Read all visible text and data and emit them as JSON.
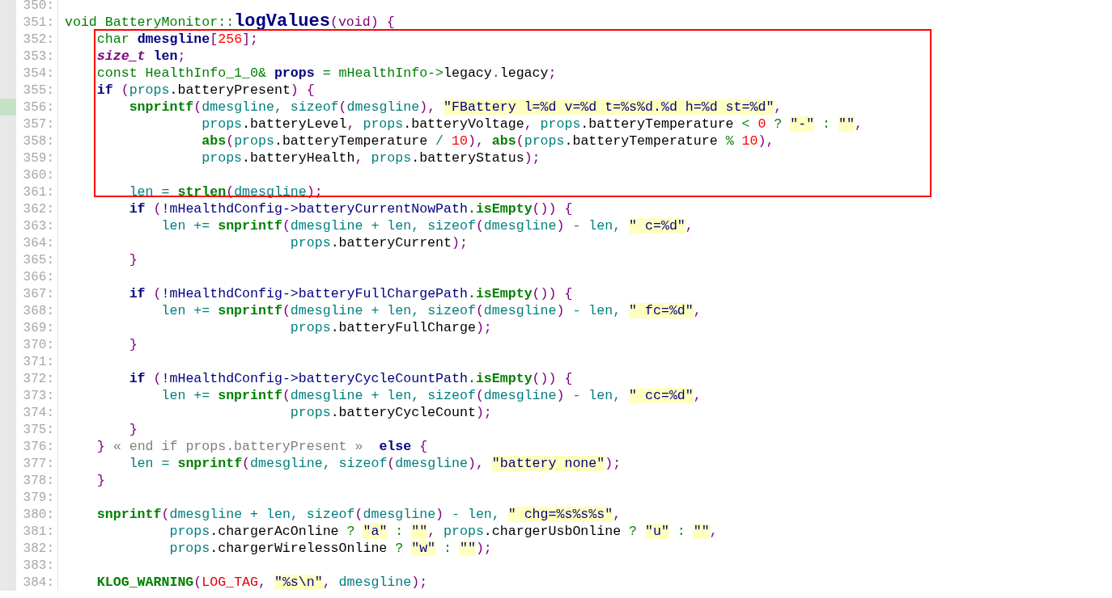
{
  "lines": [
    {
      "number": "350:",
      "changed": false
    },
    {
      "number": "351:",
      "changed": false,
      "tokens": [
        {
          "kind": "type",
          "text": "void BatteryMonitor::"
        },
        {
          "kind": "title",
          "text": "logValues"
        },
        {
          "kind": "punct",
          "text": "(void) {"
        }
      ]
    },
    {
      "number": "352:",
      "changed": false,
      "tokens": [
        {
          "kind": "type",
          "text": "    char "
        },
        {
          "kind": "decl",
          "text": "dmesgline"
        },
        {
          "kind": "punct",
          "text": "["
        },
        {
          "kind": "number",
          "text": "256"
        },
        {
          "kind": "punct",
          "text": "];"
        }
      ]
    },
    {
      "number": "353:",
      "changed": false,
      "tokens": [
        {
          "kind": "italic",
          "text": "    size_t"
        },
        {
          "kind": "decl",
          "text": " len"
        },
        {
          "kind": "punct",
          "text": ";"
        }
      ]
    },
    {
      "number": "354:",
      "changed": false,
      "tokens": [
        {
          "kind": "type",
          "text": "    const HealthInfo_1_0& "
        },
        {
          "kind": "decl",
          "text": "props"
        },
        {
          "kind": "type",
          "text": " = mHealthInfo->"
        },
        {
          "kind": "plain",
          "text": "legacy"
        },
        {
          "kind": "type",
          "text": "."
        },
        {
          "kind": "plain",
          "text": "legacy"
        },
        {
          "kind": "punct",
          "text": ";"
        }
      ]
    },
    {
      "number": "355:",
      "changed": false,
      "tokens": [
        {
          "kind": "decl",
          "text": "    if "
        },
        {
          "kind": "punct",
          "text": "("
        },
        {
          "kind": "var",
          "text": "props"
        },
        {
          "kind": "plain",
          "text": ".batteryPresent"
        },
        {
          "kind": "punct",
          "text": ") {"
        }
      ]
    },
    {
      "number": "356:",
      "changed": true,
      "tokens": [
        {
          "kind": "func",
          "text": "        snprintf"
        },
        {
          "kind": "punct",
          "text": "("
        },
        {
          "kind": "var",
          "text": "dmesgline, sizeof"
        },
        {
          "kind": "punct",
          "text": "("
        },
        {
          "kind": "var",
          "text": "dmesgline"
        },
        {
          "kind": "punct",
          "text": "), "
        },
        {
          "kind": "string",
          "text": "\"FBattery l=%d v=%d t=%s%d.%d h=%d st=%d\""
        },
        {
          "kind": "punct",
          "text": ","
        }
      ]
    },
    {
      "number": "357:",
      "changed": false,
      "tokens": [
        {
          "kind": "var",
          "text": "                 props"
        },
        {
          "kind": "plain",
          "text": ".batteryLevel"
        },
        {
          "kind": "punct",
          "text": ", "
        },
        {
          "kind": "var",
          "text": "props"
        },
        {
          "kind": "plain",
          "text": ".batteryVoltage"
        },
        {
          "kind": "punct",
          "text": ", "
        },
        {
          "kind": "var",
          "text": "props"
        },
        {
          "kind": "plain",
          "text": ".batteryTemperature "
        },
        {
          "kind": "op",
          "text": "< "
        },
        {
          "kind": "number",
          "text": "0"
        },
        {
          "kind": "op",
          "text": " ? "
        },
        {
          "kind": "string",
          "text": "\"-\""
        },
        {
          "kind": "op",
          "text": " : "
        },
        {
          "kind": "string",
          "text": "\"\""
        },
        {
          "kind": "punct",
          "text": ","
        }
      ]
    },
    {
      "number": "358:",
      "changed": false,
      "tokens": [
        {
          "kind": "func",
          "text": "                 abs"
        },
        {
          "kind": "punct",
          "text": "("
        },
        {
          "kind": "var",
          "text": "props"
        },
        {
          "kind": "plain",
          "text": ".batteryTemperature "
        },
        {
          "kind": "var",
          "text": "/ "
        },
        {
          "kind": "number",
          "text": "10"
        },
        {
          "kind": "punct",
          "text": "), "
        },
        {
          "kind": "func",
          "text": "abs"
        },
        {
          "kind": "punct",
          "text": "("
        },
        {
          "kind": "var",
          "text": "props"
        },
        {
          "kind": "plain",
          "text": ".batteryTemperature "
        },
        {
          "kind": "op",
          "text": "% "
        },
        {
          "kind": "number",
          "text": "10"
        },
        {
          "kind": "punct",
          "text": "),"
        }
      ]
    },
    {
      "number": "359:",
      "changed": false,
      "tokens": [
        {
          "kind": "var",
          "text": "                 props"
        },
        {
          "kind": "plain",
          "text": ".batteryHealth"
        },
        {
          "kind": "punct",
          "text": ", "
        },
        {
          "kind": "var",
          "text": "props"
        },
        {
          "kind": "plain",
          "text": ".batteryStatus"
        },
        {
          "kind": "punct",
          "text": ");"
        }
      ]
    },
    {
      "number": "360:",
      "changed": false
    },
    {
      "number": "361:",
      "changed": false,
      "tokens": [
        {
          "kind": "var",
          "text": "        len = "
        },
        {
          "kind": "func",
          "text": "strlen"
        },
        {
          "kind": "punct",
          "text": "("
        },
        {
          "kind": "var",
          "text": "dmesgline"
        },
        {
          "kind": "punct",
          "text": ");"
        }
      ]
    },
    {
      "number": "362:",
      "changed": false,
      "tokens": [
        {
          "kind": "decl",
          "text": "        if "
        },
        {
          "kind": "punct",
          "text": "("
        },
        {
          "kind": "member",
          "text": "!mHealthdConfig->batteryCurrentNowPath"
        },
        {
          "kind": "func",
          "text": ".isEmpty"
        },
        {
          "kind": "punct",
          "text": "()) {"
        }
      ]
    },
    {
      "number": "363:",
      "changed": false,
      "tokens": [
        {
          "kind": "var",
          "text": "            len += "
        },
        {
          "kind": "func",
          "text": "snprintf"
        },
        {
          "kind": "punct",
          "text": "("
        },
        {
          "kind": "var",
          "text": "dmesgline + len, sizeof"
        },
        {
          "kind": "punct",
          "text": "("
        },
        {
          "kind": "var",
          "text": "dmesgline"
        },
        {
          "kind": "punct",
          "text": ") "
        },
        {
          "kind": "var",
          "text": "- len, "
        },
        {
          "kind": "string",
          "text": "\" c=%d\""
        },
        {
          "kind": "punct",
          "text": ","
        }
      ]
    },
    {
      "number": "364:",
      "changed": false,
      "tokens": [
        {
          "kind": "var",
          "text": "                            props"
        },
        {
          "kind": "plain",
          "text": ".batteryCurrent"
        },
        {
          "kind": "punct",
          "text": ");"
        }
      ]
    },
    {
      "number": "365:",
      "changed": false,
      "tokens": [
        {
          "kind": "punct",
          "text": "        }"
        }
      ]
    },
    {
      "number": "366:",
      "changed": false
    },
    {
      "number": "367:",
      "changed": false,
      "tokens": [
        {
          "kind": "decl",
          "text": "        if "
        },
        {
          "kind": "punct",
          "text": "("
        },
        {
          "kind": "member",
          "text": "!mHealthdConfig->batteryFullChargePath"
        },
        {
          "kind": "func",
          "text": ".isEmpty"
        },
        {
          "kind": "punct",
          "text": "()) {"
        }
      ]
    },
    {
      "number": "368:",
      "changed": false,
      "tokens": [
        {
          "kind": "var",
          "text": "            len += "
        },
        {
          "kind": "func",
          "text": "snprintf"
        },
        {
          "kind": "punct",
          "text": "("
        },
        {
          "kind": "var",
          "text": "dmesgline + len, sizeof"
        },
        {
          "kind": "punct",
          "text": "("
        },
        {
          "kind": "var",
          "text": "dmesgline"
        },
        {
          "kind": "punct",
          "text": ") "
        },
        {
          "kind": "var",
          "text": "- len, "
        },
        {
          "kind": "string",
          "text": "\" fc=%d\""
        },
        {
          "kind": "punct",
          "text": ","
        }
      ]
    },
    {
      "number": "369:",
      "changed": false,
      "tokens": [
        {
          "kind": "var",
          "text": "                            props"
        },
        {
          "kind": "plain",
          "text": ".batteryFullCharge"
        },
        {
          "kind": "punct",
          "text": ");"
        }
      ]
    },
    {
      "number": "370:",
      "changed": false,
      "tokens": [
        {
          "kind": "punct",
          "text": "        }"
        }
      ]
    },
    {
      "number": "371:",
      "changed": false
    },
    {
      "number": "372:",
      "changed": false,
      "tokens": [
        {
          "kind": "decl",
          "text": "        if "
        },
        {
          "kind": "punct",
          "text": "("
        },
        {
          "kind": "member",
          "text": "!mHealthdConfig->batteryCycleCountPath"
        },
        {
          "kind": "func",
          "text": ".isEmpty"
        },
        {
          "kind": "punct",
          "text": "()) {"
        }
      ]
    },
    {
      "number": "373:",
      "changed": false,
      "tokens": [
        {
          "kind": "var",
          "text": "            len += "
        },
        {
          "kind": "func",
          "text": "snprintf"
        },
        {
          "kind": "punct",
          "text": "("
        },
        {
          "kind": "var",
          "text": "dmesgline + len, sizeof"
        },
        {
          "kind": "punct",
          "text": "("
        },
        {
          "kind": "var",
          "text": "dmesgline"
        },
        {
          "kind": "punct",
          "text": ") "
        },
        {
          "kind": "var",
          "text": "- len, "
        },
        {
          "kind": "string",
          "text": "\" cc=%d\""
        },
        {
          "kind": "punct",
          "text": ","
        }
      ]
    },
    {
      "number": "374:",
      "changed": false,
      "tokens": [
        {
          "kind": "var",
          "text": "                            props"
        },
        {
          "kind": "plain",
          "text": ".batteryCycleCount"
        },
        {
          "kind": "punct",
          "text": ");"
        }
      ]
    },
    {
      "number": "375:",
      "changed": false,
      "tokens": [
        {
          "kind": "punct",
          "text": "        }"
        }
      ]
    },
    {
      "number": "376:",
      "changed": false,
      "tokens": [
        {
          "kind": "punct",
          "text": "    }"
        },
        {
          "kind": "comment",
          "text": " « end if props.batteryPresent »  "
        },
        {
          "kind": "decl",
          "text": "else "
        },
        {
          "kind": "punct",
          "text": "{"
        }
      ]
    },
    {
      "number": "377:",
      "changed": false,
      "tokens": [
        {
          "kind": "var",
          "text": "        len = "
        },
        {
          "kind": "func",
          "text": "snprintf"
        },
        {
          "kind": "punct",
          "text": "("
        },
        {
          "kind": "var",
          "text": "dmesgline, sizeof"
        },
        {
          "kind": "punct",
          "text": "("
        },
        {
          "kind": "var",
          "text": "dmesgline"
        },
        {
          "kind": "punct",
          "text": "), "
        },
        {
          "kind": "string",
          "text": "\"battery none\""
        },
        {
          "kind": "punct",
          "text": ");"
        }
      ]
    },
    {
      "number": "378:",
      "changed": false,
      "tokens": [
        {
          "kind": "punct",
          "text": "    }"
        }
      ]
    },
    {
      "number": "379:",
      "changed": false
    },
    {
      "number": "380:",
      "changed": false,
      "tokens": [
        {
          "kind": "func",
          "text": "    snprintf"
        },
        {
          "kind": "punct",
          "text": "("
        },
        {
          "kind": "var",
          "text": "dmesgline + len, sizeof"
        },
        {
          "kind": "punct",
          "text": "("
        },
        {
          "kind": "var",
          "text": "dmesgline"
        },
        {
          "kind": "punct",
          "text": ") "
        },
        {
          "kind": "var",
          "text": "- len, "
        },
        {
          "kind": "string",
          "text": "\" chg=%s%s%s\""
        },
        {
          "kind": "punct",
          "text": ","
        }
      ]
    },
    {
      "number": "381:",
      "changed": false,
      "tokens": [
        {
          "kind": "var",
          "text": "             props"
        },
        {
          "kind": "plain",
          "text": ".chargerAcOnline "
        },
        {
          "kind": "op",
          "text": "? "
        },
        {
          "kind": "string",
          "text": "\"a\""
        },
        {
          "kind": "op",
          "text": " : "
        },
        {
          "kind": "string",
          "text": "\"\""
        },
        {
          "kind": "punct",
          "text": ", "
        },
        {
          "kind": "var",
          "text": "props"
        },
        {
          "kind": "plain",
          "text": ".chargerUsbOnline "
        },
        {
          "kind": "op",
          "text": "? "
        },
        {
          "kind": "string",
          "text": "\"u\""
        },
        {
          "kind": "op",
          "text": " : "
        },
        {
          "kind": "string",
          "text": "\"\""
        },
        {
          "kind": "punct",
          "text": ","
        }
      ]
    },
    {
      "number": "382:",
      "changed": false,
      "tokens": [
        {
          "kind": "var",
          "text": "             props"
        },
        {
          "kind": "plain",
          "text": ".chargerWirelessOnline "
        },
        {
          "kind": "op",
          "text": "? "
        },
        {
          "kind": "string",
          "text": "\"w\""
        },
        {
          "kind": "op",
          "text": " : "
        },
        {
          "kind": "string",
          "text": "\"\""
        },
        {
          "kind": "punct",
          "text": ");"
        }
      ]
    },
    {
      "number": "383:",
      "changed": false
    },
    {
      "number": "384:",
      "changed": false,
      "tokens": [
        {
          "kind": "func",
          "text": "    KLOG_WARNING"
        },
        {
          "kind": "punct",
          "text": "("
        },
        {
          "kind": "macro",
          "text": "LOG_TAG"
        },
        {
          "kind": "punct",
          "text": ", "
        },
        {
          "kind": "string",
          "text": "\"%s\\n\""
        },
        {
          "kind": "punct",
          "text": ", "
        },
        {
          "kind": "var",
          "text": "dmesgline"
        },
        {
          "kind": "punct",
          "text": ");"
        }
      ]
    }
  ]
}
